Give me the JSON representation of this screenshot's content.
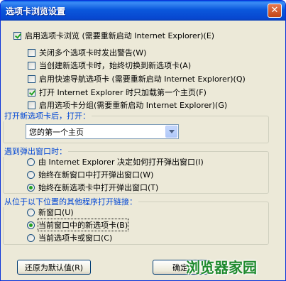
{
  "window": {
    "title": "选项卡浏览设置",
    "close_glyph": "✕"
  },
  "main_option": {
    "label": "启用选项卡浏览 (需要重新启动 Internet Explorer)(E)",
    "checked": true
  },
  "sub_options": [
    {
      "label": "关闭多个选项卡时发出警告(W)",
      "checked": false
    },
    {
      "label": "当创建新选项卡时，始终切换到新选项卡(A)",
      "checked": false
    },
    {
      "label": "启用快速导航选项卡 (需要重新启动 Internet Explorer)(Q)",
      "checked": false
    },
    {
      "label": "打开 Internet Explorer 时只加载第一个主页(F)",
      "checked": true
    },
    {
      "label": "启用选项卡分组(需要重新启动 Internet Explorer)(G)",
      "checked": false
    }
  ],
  "new_tab_group": {
    "title": "打开新选项卡后，打开：",
    "selected": "您的第一个主页"
  },
  "popup_group": {
    "title": "遇到弹出窗口时：",
    "options": [
      {
        "label": "由 Internet Explorer 决定如何打开弹出窗口(I)",
        "selected": false
      },
      {
        "label": "始终在新窗口中打开弹出窗口(W)",
        "selected": false
      },
      {
        "label": "始终在新选项卡中打开弹出窗口(T)",
        "selected": true
      }
    ]
  },
  "external_group": {
    "title": "从位于以下位置的其他程序打开链接：",
    "options": [
      {
        "label": "新窗口(U)",
        "selected": false
      },
      {
        "label": "当前窗口中的新选项卡(B)",
        "selected": true
      },
      {
        "label": "当前选项卡或窗口(C)",
        "selected": false
      }
    ]
  },
  "buttons": {
    "restore": "还原为默认值(R)",
    "ok": "确定"
  },
  "watermark": "浏览器家园"
}
